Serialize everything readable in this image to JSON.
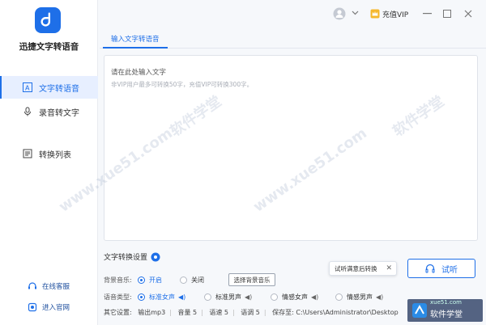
{
  "app": {
    "name": "迅捷文字转语音",
    "brand_color": "#1e6fe8"
  },
  "sidebar": {
    "items": [
      {
        "label": "文字转语音",
        "icon": "text-to-speech-icon",
        "active": true
      },
      {
        "label": "录音转文字",
        "icon": "microphone-icon",
        "active": false
      },
      {
        "label": "转换列表",
        "icon": "list-icon",
        "active": false
      }
    ],
    "links": [
      {
        "label": "在线客服",
        "icon": "headset-icon"
      },
      {
        "label": "进入官网",
        "icon": "globe-icon"
      }
    ]
  },
  "titlebar": {
    "vip_label": "充值VIP"
  },
  "tabs": [
    {
      "label": "输入文字转语音",
      "active": true
    }
  ],
  "editor": {
    "placeholder": "请在此处输入文字",
    "hint": "非VIP用户最多可转换50字，充值VIP可转换300字。"
  },
  "settings": {
    "title": "文字转换设置",
    "bg_music": {
      "label": "背景音乐:",
      "options": [
        "开启",
        "关闭"
      ],
      "selected": "开启",
      "button": "选择背景音乐"
    },
    "voice": {
      "label": "语音类型:",
      "options": [
        "标准女声",
        "标准男声",
        "情感女声",
        "情感男声"
      ],
      "selected": "标准女声"
    },
    "other": {
      "label": "其它设置:",
      "format": "输出mp3",
      "volume": "音量 5",
      "speed": "语速 5",
      "pitch": "语调 5",
      "save_to": "保存至: C:\\Users\\Administrator\\Desktop"
    }
  },
  "tooltip": {
    "text": "试听满意后转换"
  },
  "listen_button": {
    "label": "试听"
  },
  "watermark": {
    "text1": "软件学堂",
    "text2": "www.xue51.com",
    "brand": "软件学堂",
    "brand_sub": "xue51.com"
  }
}
